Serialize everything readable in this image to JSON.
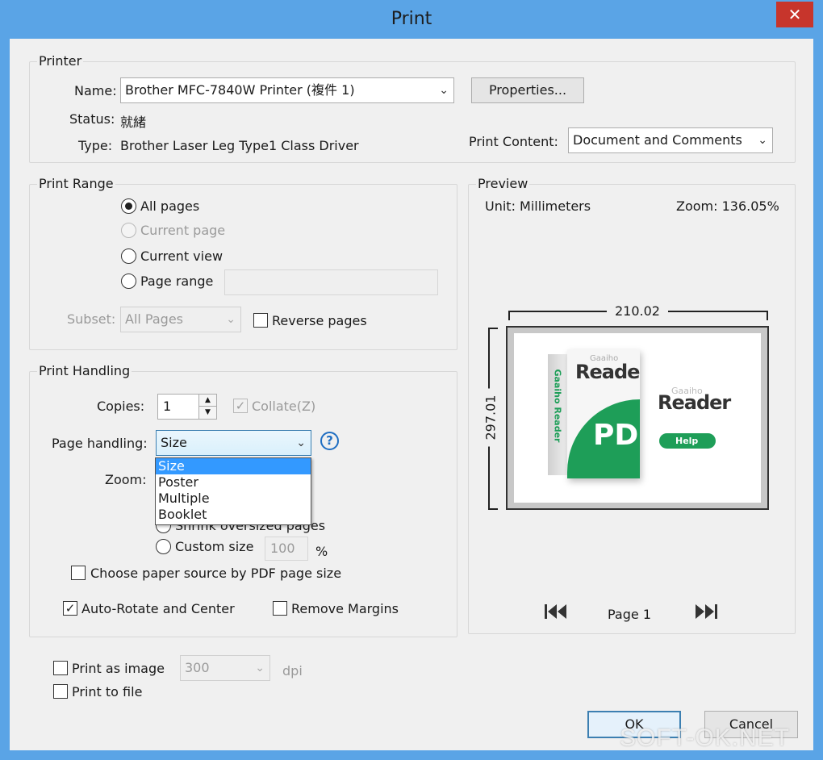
{
  "window": {
    "title": "Print",
    "close_glyph": "✕"
  },
  "printer": {
    "group_title": "Printer",
    "name_label": "Name:",
    "name_value": "Brother MFC-7840W Printer (複件 1)",
    "properties_label": "Properties...",
    "status_label": "Status:",
    "status_value": "就緒",
    "type_label": "Type:",
    "type_value": "Brother Laser Leg Type1 Class Driver",
    "print_content_label": "Print Content:",
    "print_content_value": "Document and Comments"
  },
  "print_range": {
    "group_title": "Print Range",
    "all_pages": "All pages",
    "current_page": "Current page",
    "current_view": "Current view",
    "page_range": "Page range",
    "page_range_value": "",
    "subset_label": "Subset:",
    "subset_value": "All Pages",
    "reverse_pages": "Reverse pages"
  },
  "print_handling": {
    "group_title": "Print Handling",
    "copies_label": "Copies:",
    "copies_value": "1",
    "collate_label": "Collate(Z)",
    "page_handling_label": "Page handling:",
    "page_handling_value": "Size",
    "page_handling_options": [
      "Size",
      "Poster",
      "Multiple",
      "Booklet"
    ],
    "zoom_label": "Zoom:",
    "shrink_label": "Shrink oversized pages",
    "custom_size_label": "Custom size",
    "custom_size_value": "100",
    "percent_label": "%",
    "paper_source_label": "Choose paper source by PDF page size",
    "auto_rotate_label": "Auto-Rotate and Center",
    "remove_margins_label": "Remove Margins"
  },
  "preview": {
    "group_title": "Preview",
    "unit_label": "Unit: Millimeters",
    "zoom_label": "Zoom: 136.05%",
    "width_dim": "210.02",
    "height_dim": "297.01",
    "page_label": "Page 1",
    "first_icon": "first-page-icon",
    "last_icon": "last-page-icon",
    "artwork": {
      "box_brand": "Gaaiho",
      "box_title": "Reader",
      "box_side": "Gaaiho Reader",
      "box_pdf": "PDF",
      "side_brand": "Gaaiho",
      "side_title": "Reader",
      "help_button": "Help"
    }
  },
  "bottom": {
    "print_as_image": "Print as image",
    "dpi_value": "300",
    "dpi_label": "dpi",
    "print_to_file": "Print to file",
    "ok_label": "OK",
    "cancel_label": "Cancel"
  },
  "watermark": "SOFT-OK.NET",
  "colors": {
    "frame": "#5aa4e6",
    "close_button": "#c7352c",
    "selection": "#3399ff",
    "brand_green": "#1e9e58"
  }
}
